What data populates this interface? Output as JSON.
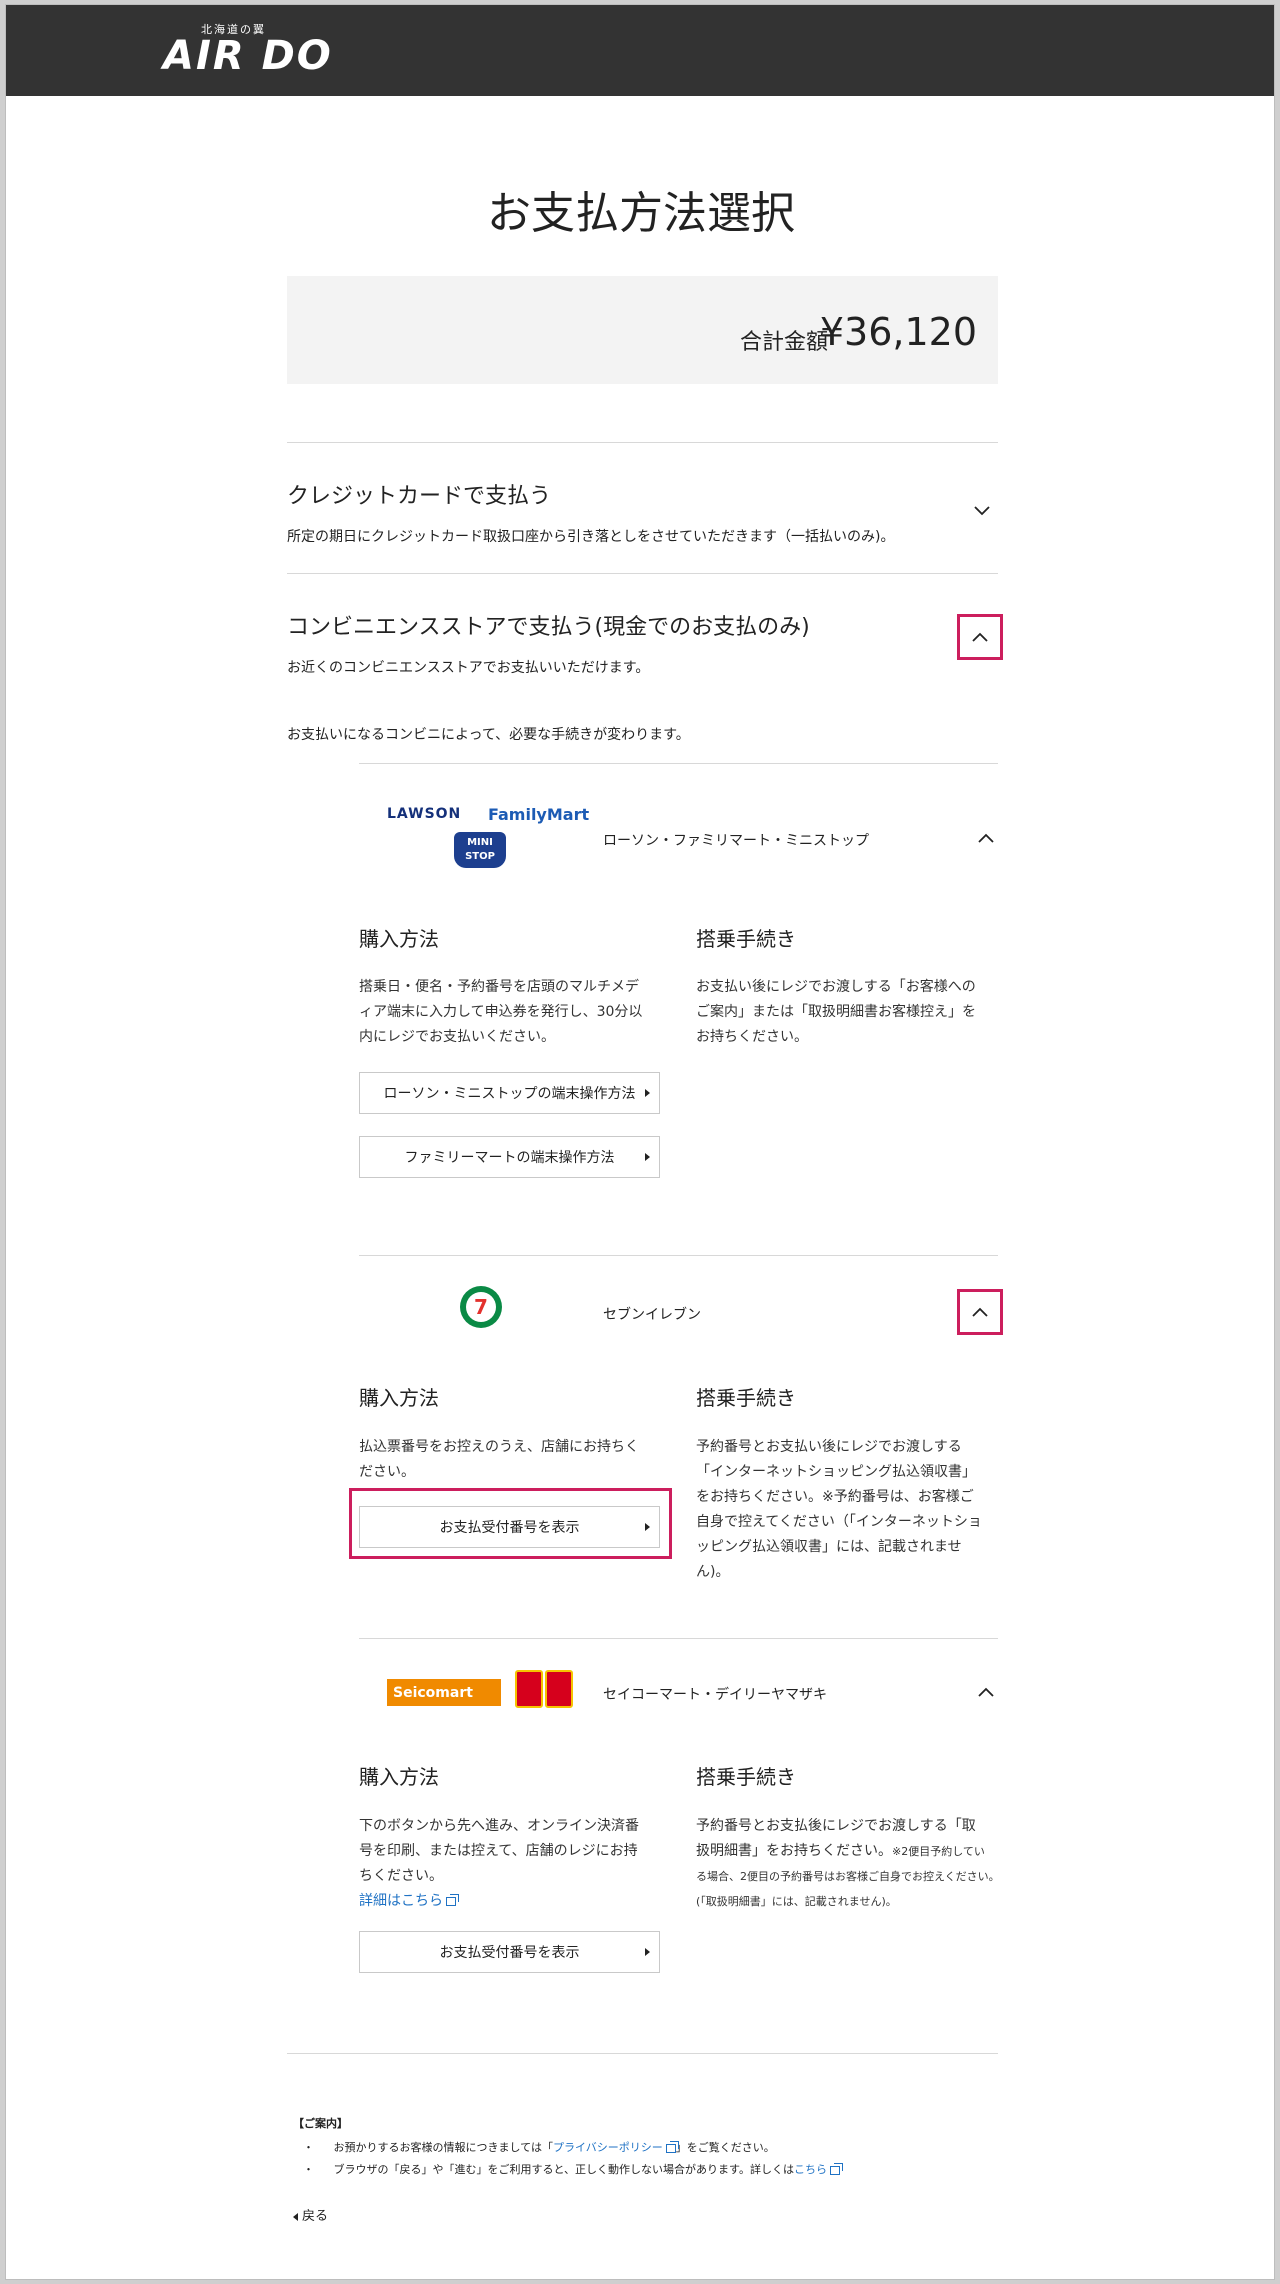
{
  "header": {
    "logo_sub": "北海道の翼",
    "logo_main": "AIR DO"
  },
  "page": {
    "title": "お支払方法選択",
    "total_label": "合計金額",
    "total_value": "¥36,120"
  },
  "credit": {
    "title": "クレジットカードで支払う",
    "desc": "所定の期日にクレジットカード取扱口座から引き落としをさせていただきます（一括払いのみ)。"
  },
  "convenience": {
    "title": "コンビニエンスストアで支払う(現金でのお支払のみ)",
    "desc": "お近くのコンビニエンスストアでお支払いいただけます。",
    "note": "お支払いになるコンビニによって、必要な手続きが変わります。"
  },
  "lawson_group": {
    "logo_lawson": "LAWSON",
    "logo_familymart": "FamilyMart",
    "logo_ministop_1": "MINI",
    "logo_ministop_2": "STOP",
    "name": "ローソン・ファミリマート・ミニストップ",
    "purchase_title": "購入方法",
    "purchase_lines": [
      "搭乗日・便名・予約番号を店頭のマルチメデ",
      "ィア端末に入力して申込券を発行し、30分以",
      "内にレジでお支払いください。"
    ],
    "boarding_title": "搭乗手続き",
    "boarding_lines": [
      "お支払い後にレジでお渡しする「お客様への",
      "ご案内」または「取扱明細書お客様控え」を",
      "お持ちください。"
    ],
    "btn_lawson": "ローソン・ミニストップの端末操作方法",
    "btn_familymart": "ファミリーマートの端末操作方法"
  },
  "seven": {
    "logo_text": "7",
    "name": "セブンイレブン",
    "purchase_title": "購入方法",
    "purchase_lines": [
      "払込票番号をお控えのうえ、店舗にお持ちく",
      "ださい。"
    ],
    "boarding_title": "搭乗手続き",
    "boarding_lines": [
      "予約番号とお支払い後にレジでお渡しする",
      "「インターネットショッピング払込領収書」",
      "をお持ちください。※予約番号は、お客様ご",
      "自身で控えてください（「インターネットショ",
      "ッピング払込領収書」には、記載されませ",
      "ん)。"
    ],
    "btn_show": "お支払受付番号を表示"
  },
  "seicomart": {
    "logo_seico": "Seicomart",
    "name": "セイコーマート・デイリーヤマザキ",
    "purchase_title": "購入方法",
    "purchase_lines": [
      "下のボタンから先へ進み、オンライン決済番",
      "号を印刷、または控えて、店舗のレジにお持",
      "ちください。"
    ],
    "detail_link": "詳細はこちら",
    "boarding_title": "搭乗手続き",
    "boarding_line1": "予約番号とお支払後にレジでお渡しする「取",
    "boarding_line2_main": "扱明細書」をお持ちください。",
    "boarding_line2_small": "※2便目予約してい",
    "boarding_line3": "る場合、2便目の予約番号はお客様ご自身でお控えください。",
    "boarding_line4": "(「取扱明細書」には、記載されません)。",
    "btn_show": "お支払受付番号を表示"
  },
  "guide": {
    "title": "【ご案内】",
    "line1_pre": "お預かりするお客様の情報につきましては「",
    "line1_link": "プライバシーポリシー",
    "line1_post": "」をご覧ください。",
    "line2_pre": "ブラウザの「戻る」や「進む」をご利用すると、正しく動作しない場合があります。詳しくは",
    "line2_link": "こちら",
    "back": "戻る"
  },
  "colors": {
    "header_bg": "#333333",
    "highlight": "#cc1e5d",
    "link": "#1f72c4",
    "total_box_bg": "#f3f3f3"
  }
}
